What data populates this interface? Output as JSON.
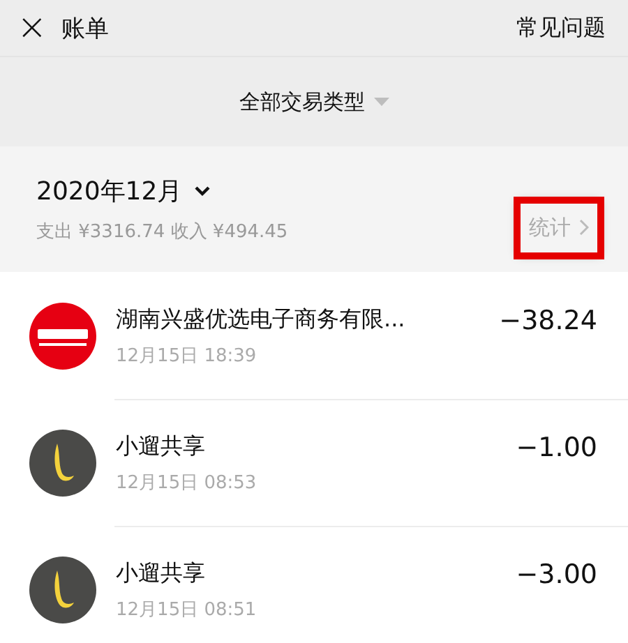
{
  "header": {
    "close": "×",
    "title": "账单",
    "help": "常见问题"
  },
  "filter": {
    "label": "全部交易类型"
  },
  "month": {
    "label": "2020年12月",
    "summary": "支出 ¥3316.74 收入 ¥494.45",
    "stats": "统计",
    "stats_highlighted": true
  },
  "transactions": [
    {
      "kind": "red-logo",
      "name": "湖南兴盛优选电子商务有限...",
      "time": "12月15日 18:39",
      "amount": "−38.24"
    },
    {
      "kind": "l-logo",
      "name": "小遛共享",
      "time": "12月15日 08:53",
      "amount": "−1.00"
    },
    {
      "kind": "l-logo",
      "name": "小遛共享",
      "time": "12月15日 08:51",
      "amount": "−3.00"
    }
  ]
}
